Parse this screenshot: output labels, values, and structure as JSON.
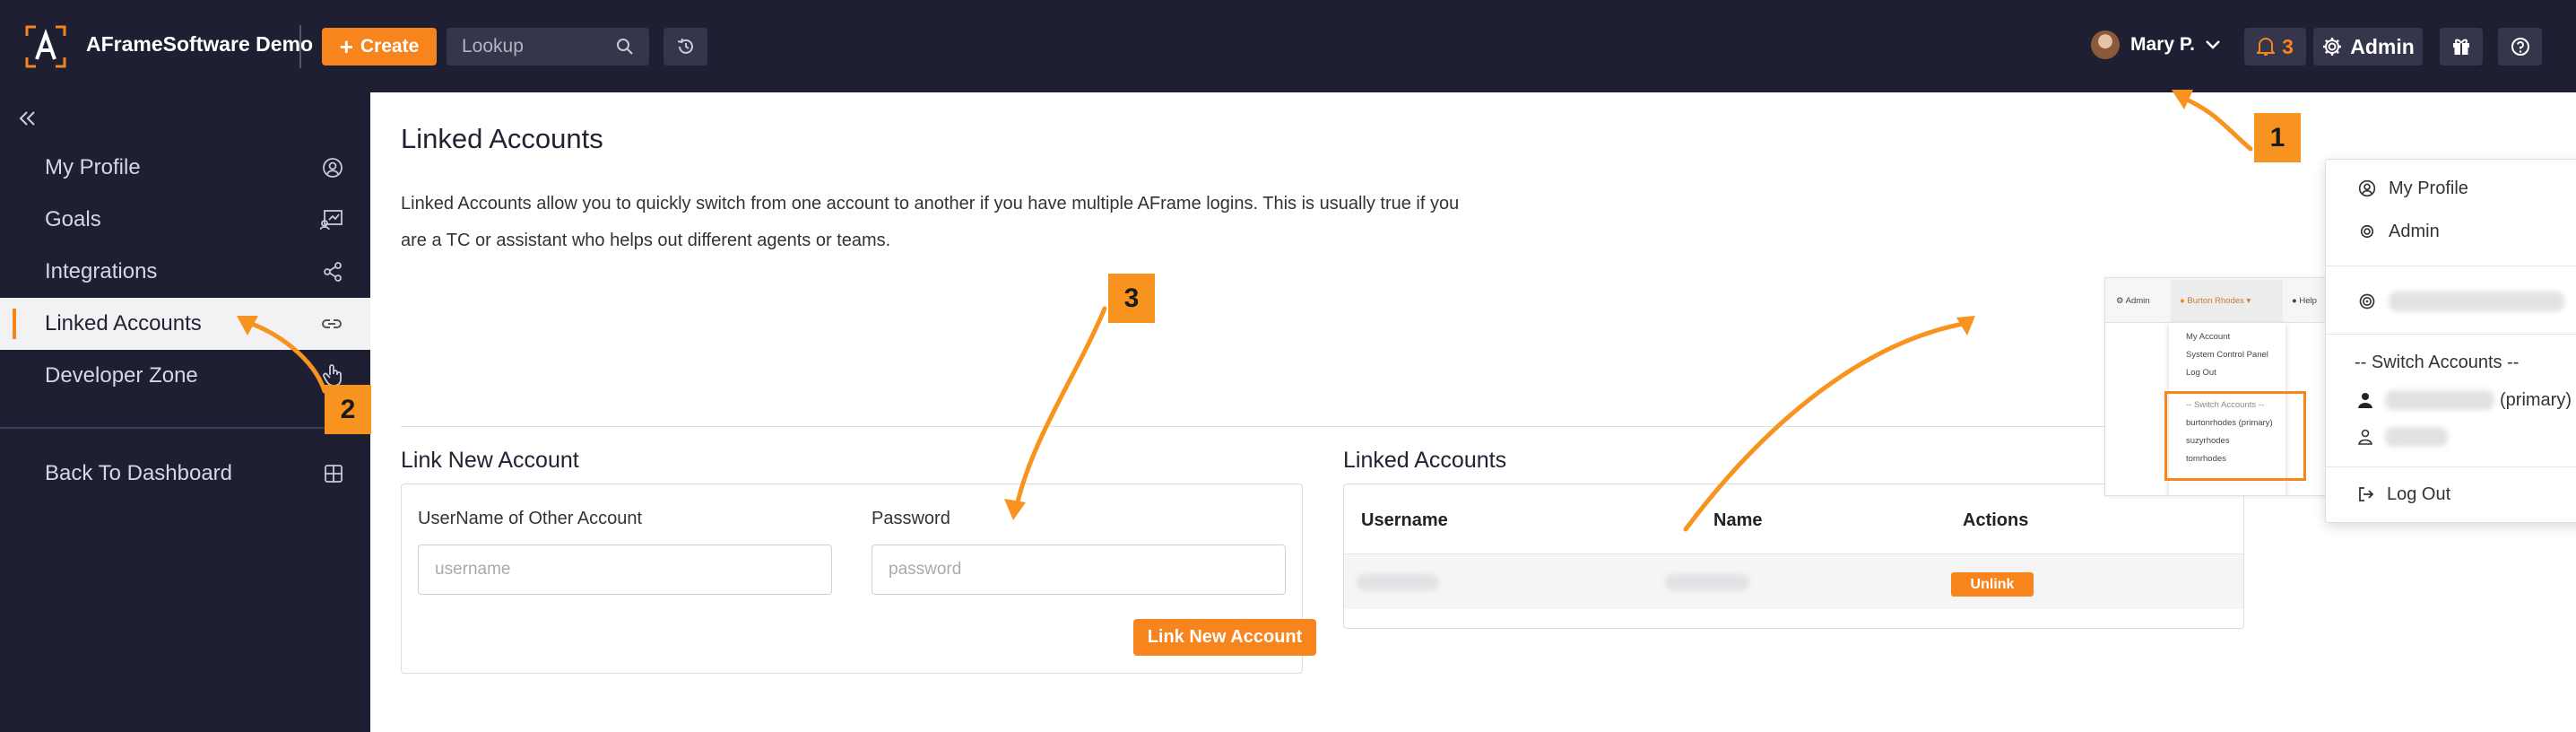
{
  "topbar": {
    "brand": "AFrameSoftware Demo",
    "create_label": "Create",
    "lookup_placeholder": "Lookup",
    "user_name": "Mary P.",
    "notification_count": "3",
    "admin_label": "Admin"
  },
  "sidebar": {
    "items": [
      {
        "label": "My Profile",
        "icon": "user-circle-icon"
      },
      {
        "label": "Goals",
        "icon": "goals-icon"
      },
      {
        "label": "Integrations",
        "icon": "share-nodes-icon"
      },
      {
        "label": "Linked Accounts",
        "icon": "link-icon",
        "active": true
      },
      {
        "label": "Developer Zone",
        "icon": "hand-pointer-icon"
      }
    ],
    "back_label": "Back To Dashboard"
  },
  "main": {
    "title": "Linked Accounts",
    "description": "Linked Accounts allow you to quickly switch from one account to another if you have multiple AFrame logins. This is usually true if you are a TC or assistant who helps out different agents or teams.",
    "link_section_title": "Link New Account",
    "username_label": "UserName of Other Account",
    "username_placeholder": "username",
    "password_label": "Password",
    "password_placeholder": "password",
    "link_button": "Link New Account",
    "linked_section_title": "Linked Accounts",
    "table": {
      "headers": [
        "Username",
        "Name",
        "Actions"
      ],
      "unlink_label": "Unlink"
    }
  },
  "thumbnail": {
    "tab_admin": "Admin",
    "tab_user": "Burton Rhodes",
    "tab_help": "Help",
    "menu_items": [
      "My Account",
      "System Control Panel",
      "Log Out"
    ],
    "switch_header": "-- Switch Accounts --",
    "accounts": [
      "burtonrhodes (primary)",
      "suzyrhodes",
      "tomrhodes"
    ]
  },
  "dropdown": {
    "my_profile": "My Profile",
    "admin": "Admin",
    "switch_header": "-- Switch Accounts --",
    "primary_suffix": "(primary)",
    "logout": "Log Out"
  },
  "callouts": [
    "1",
    "2",
    "3"
  ],
  "colors": {
    "accent": "#f7841c",
    "nav_bg": "#1f1f33",
    "callout": "#f7931e"
  }
}
